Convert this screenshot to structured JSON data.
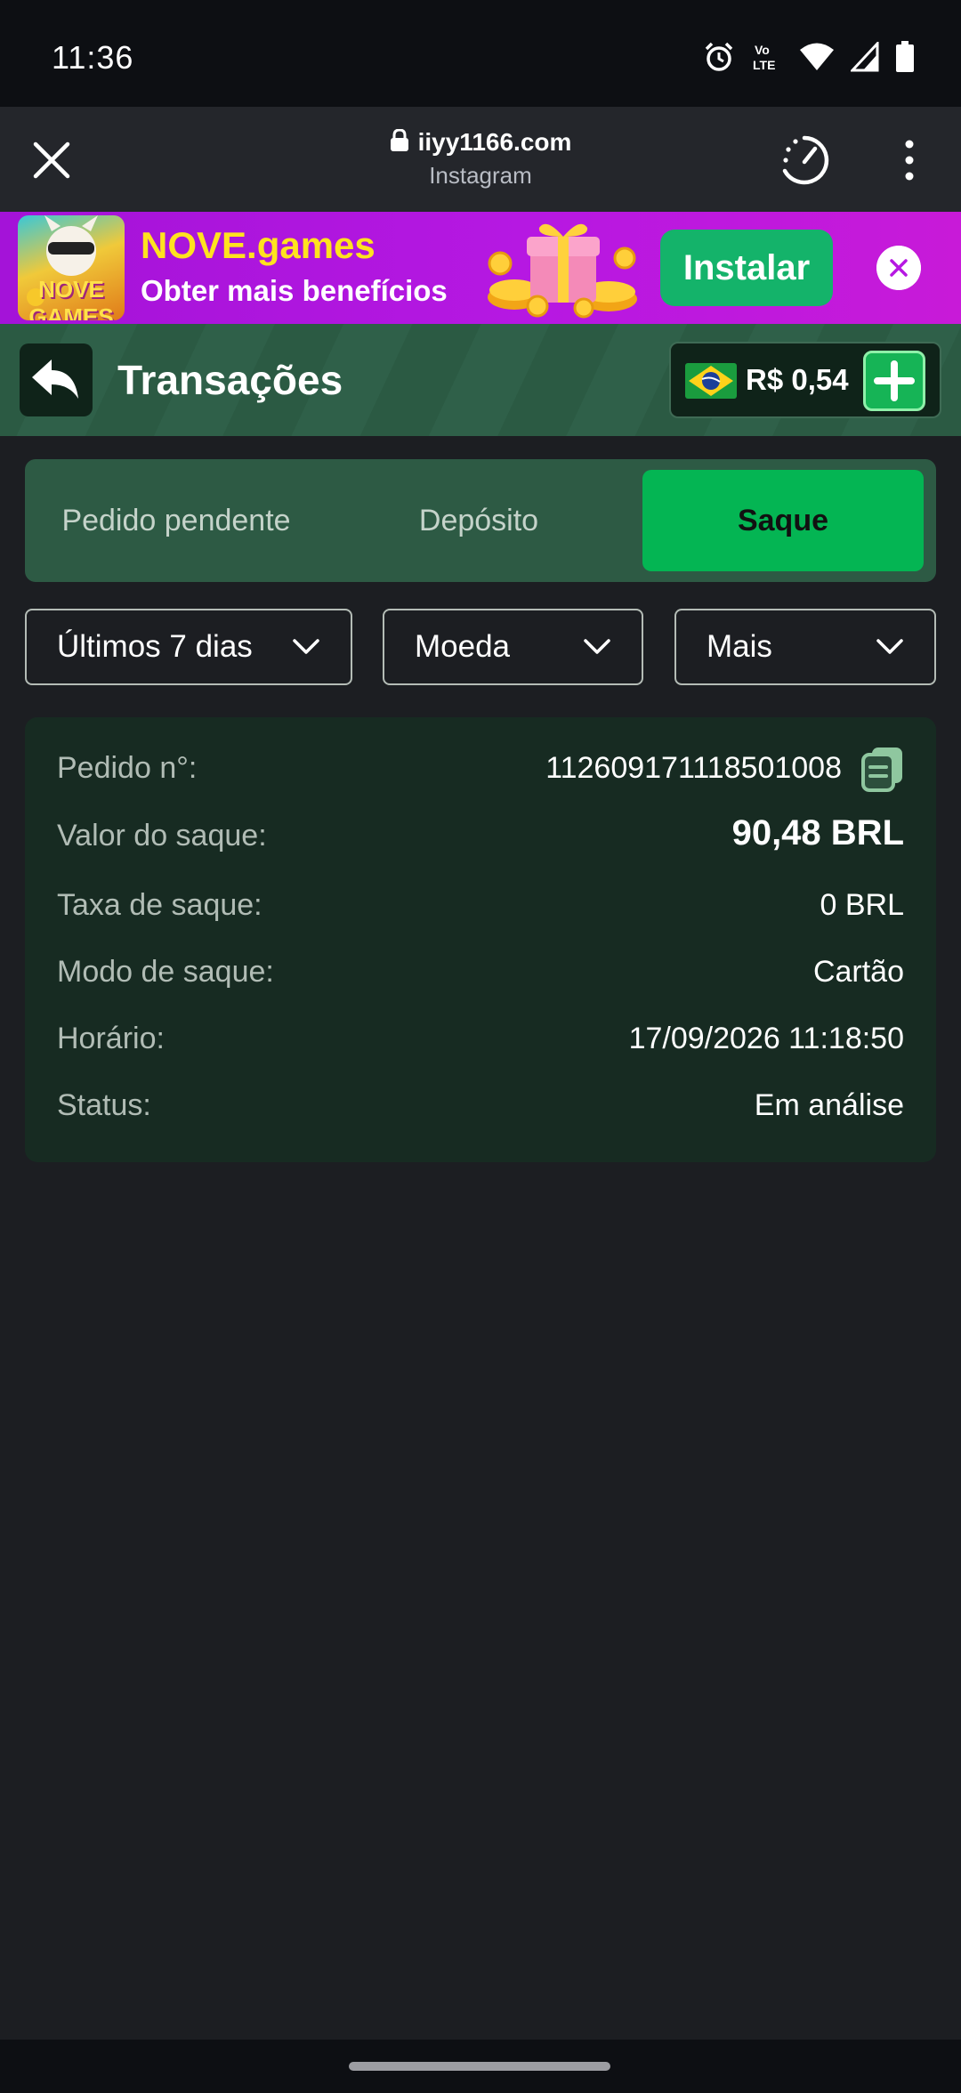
{
  "status_bar": {
    "time": "11:36",
    "icons": [
      "alarm-icon",
      "volte-icon",
      "wifi-icon",
      "signal-icon",
      "battery-icon"
    ],
    "volte_text": "Vo LTE"
  },
  "browser": {
    "url": "iiyy1166.com",
    "source": "Instagram"
  },
  "banner": {
    "title": "NOVE.games",
    "subtitle": "Obter mais benefícios",
    "logo_text": "NOVE GAMES",
    "install_label": "Instalar"
  },
  "header": {
    "title": "Transações",
    "balance": "R$ 0,54"
  },
  "tabs": [
    {
      "label": "Pedido pendente",
      "active": false
    },
    {
      "label": "Depósito",
      "active": false
    },
    {
      "label": "Saque",
      "active": true
    }
  ],
  "filters": {
    "period": "Últimos 7 dias",
    "currency": "Moeda",
    "more": "Mais"
  },
  "transaction": {
    "order_label": "Pedido n°:",
    "order_value": "112609171118501008",
    "amount_label": "Valor do saque:",
    "amount_value": "90,48 BRL",
    "fee_label": "Taxa de saque:",
    "fee_value": "0 BRL",
    "mode_label": "Modo de saque:",
    "mode_value": "Cartão",
    "time_label": "Horário:",
    "time_value": "17/09/2026 11:18:50",
    "status_label": "Status:",
    "status_value": "Em análise"
  },
  "colors": {
    "accent_green": "#04b553",
    "banner_purple": "#b618e2",
    "banner_yellow": "#ffe21f",
    "card_bg": "#172b22"
  }
}
